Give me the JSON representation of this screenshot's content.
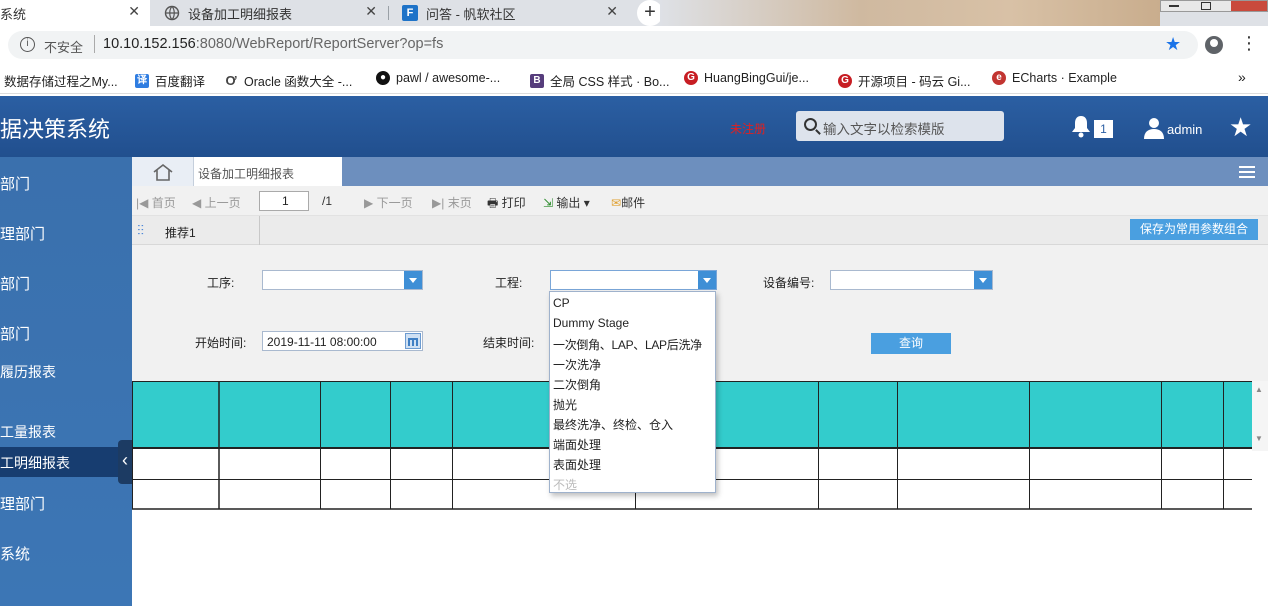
{
  "browser": {
    "tabs": [
      {
        "label": "系统",
        "active": true
      },
      {
        "label": "设备加工明细报表",
        "active": false
      },
      {
        "label": "问答 - 帆软社区",
        "active": false
      }
    ],
    "new_tab": "+",
    "security_label": "不安全",
    "url_host": "10.10.152.156",
    "url_rest": ":8080/WebReport/ReportServer?op=fs",
    "bookmarks": [
      {
        "label": "数据存储过程之My...",
        "icon": "none"
      },
      {
        "label": "百度翻译",
        "icon": "translate-icon",
        "color": "#2f7de1"
      },
      {
        "label": "Oracle 函数大全 -...",
        "icon": "oracle-icon",
        "color": "#444444"
      },
      {
        "label": "pawl / awesome-...",
        "icon": "github-icon",
        "color": "#111111"
      },
      {
        "label": "全局 CSS 样式 · Bo...",
        "icon": "bootstrap-icon",
        "color": "#563d7c"
      },
      {
        "label": "HuangBingGui/je...",
        "icon": "gitee-icon",
        "color": "#c71d23"
      },
      {
        "label": "开源项目 - 码云 Gi...",
        "icon": "gitee-icon",
        "color": "#c71d23"
      },
      {
        "label": "ECharts · Example",
        "icon": "echarts-icon",
        "color": "#c23531"
      }
    ],
    "more": "»"
  },
  "app": {
    "title": "据决策系统",
    "unregistered": "未注册",
    "search_placeholder": "输入文字以检索模版",
    "notification_count": "1",
    "user": "admin"
  },
  "sidebar": {
    "items": [
      {
        "label": "部门",
        "active": false
      },
      {
        "label": "理部门",
        "active": false
      },
      {
        "label": "部门",
        "active": false
      },
      {
        "label": "部门",
        "active": false
      },
      {
        "label": "履历报表",
        "active": false
      },
      {
        "label": "工量报表",
        "active": false
      },
      {
        "label": "工明细报表",
        "active": true
      },
      {
        "label": "理部门",
        "active": false
      },
      {
        "label": "系统",
        "active": false
      }
    ],
    "collapse_glyph": "‹"
  },
  "content": {
    "tab_label": "设备加工明细报表",
    "toolbar": {
      "first": "首页",
      "prev": "上一页",
      "page_value": "1",
      "page_total": "/1",
      "next": "下一页",
      "last": "末页",
      "print": "打印",
      "export": "输出",
      "email": "邮件"
    },
    "param_tab": "推荐1",
    "save_params": "保存为常用参数组合",
    "params": {
      "process_label": "工序:",
      "process_value": "",
      "project_label": "工程:",
      "project_value": "",
      "device_label": "设备编号:",
      "device_value": "",
      "start_label": "开始时间:",
      "start_value": "2019-11-11 08:00:00",
      "end_label": "结束时间:",
      "query": "查询"
    },
    "dropdown_options": [
      "CP",
      "Dummy Stage",
      "一次倒角、LAP、LAP后洗净",
      "一次洗净",
      "二次倒角",
      "抛光",
      "最终洗净、终检、仓入",
      "端面处理",
      "表面处理",
      "不选"
    ]
  },
  "colors": {
    "header_blue": "#2b5fa3",
    "sidebar_blue": "#3a70ad",
    "table_header": "#33cccc",
    "accent_button": "#4a9fe0"
  }
}
